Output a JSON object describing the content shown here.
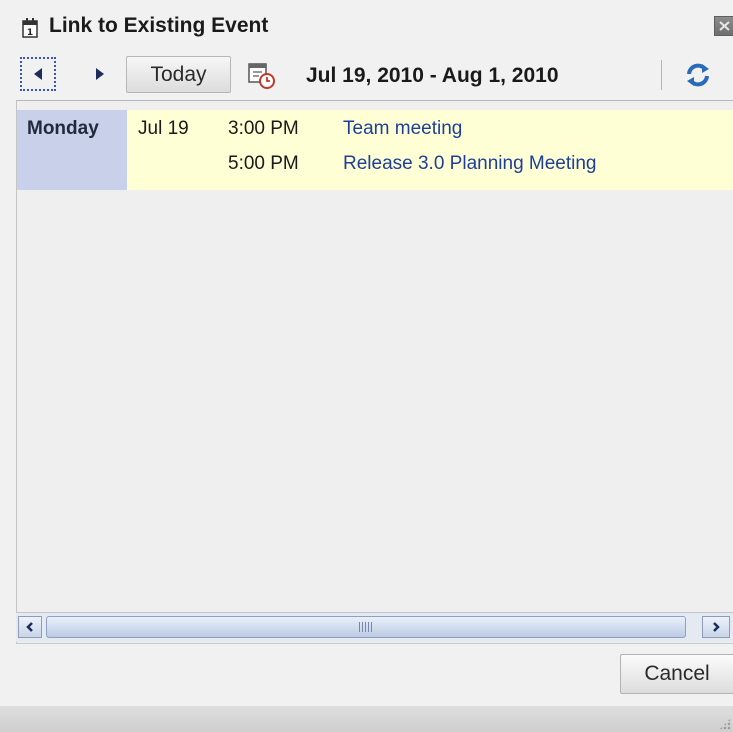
{
  "dialog": {
    "title": "Link to Existing Event",
    "title_icon": "calendar-icon",
    "close_icon": "close-icon"
  },
  "toolbar": {
    "prev_icon": "arrow-left-icon",
    "next_icon": "arrow-right-icon",
    "today_label": "Today",
    "date_picker_icon": "calendar-clock-icon",
    "date_range": "Jul 19, 2010 - Aug 1, 2010",
    "refresh_icon": "refresh-icon"
  },
  "agenda": {
    "days": [
      {
        "day_name": "Monday",
        "date": "Jul 19",
        "events": [
          {
            "time": "3:00 PM",
            "title": "Team meeting"
          },
          {
            "time": "5:00 PM",
            "title": "Release 3.0 Planning Meeting"
          }
        ]
      }
    ]
  },
  "footer": {
    "cancel_label": "Cancel"
  },
  "colors": {
    "day_group_bg": "#ffffd6",
    "day_cell_bg": "#c9d0e9",
    "event_link": "#1d3f9a",
    "focus_border": "#3a55b8"
  }
}
